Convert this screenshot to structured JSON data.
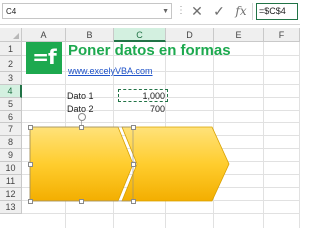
{
  "formula_bar": {
    "name_box": "C4",
    "cancel_icon": "✕",
    "enter_icon": "✓",
    "fx_icon": "fx",
    "formula": "=$C$4"
  },
  "columns": [
    "A",
    "B",
    "C",
    "D",
    "E",
    "F"
  ],
  "selected_column": "C",
  "rows": [
    "1",
    "2",
    "3",
    "4",
    "5",
    "6",
    "7",
    "8",
    "9",
    "10",
    "11",
    "12",
    "13"
  ],
  "selected_row": "4",
  "header": {
    "logo_text": "=f",
    "title": "Poner datos en formas",
    "link": "www.excelyVBA.com"
  },
  "data": [
    {
      "label": "Dato 1",
      "value": "1,000"
    },
    {
      "label": "Dato 2",
      "value": "700"
    }
  ],
  "colors": {
    "brand_green": "#1da94f",
    "shape_fill_top": "#ffe08a",
    "shape_fill_bottom": "#f5b400",
    "selection_green": "#217346"
  },
  "shapes": [
    {
      "type": "chevron",
      "fill": "yellow-gradient",
      "selected": true
    },
    {
      "type": "chevron",
      "fill": "yellow-gradient",
      "selected": false
    }
  ]
}
